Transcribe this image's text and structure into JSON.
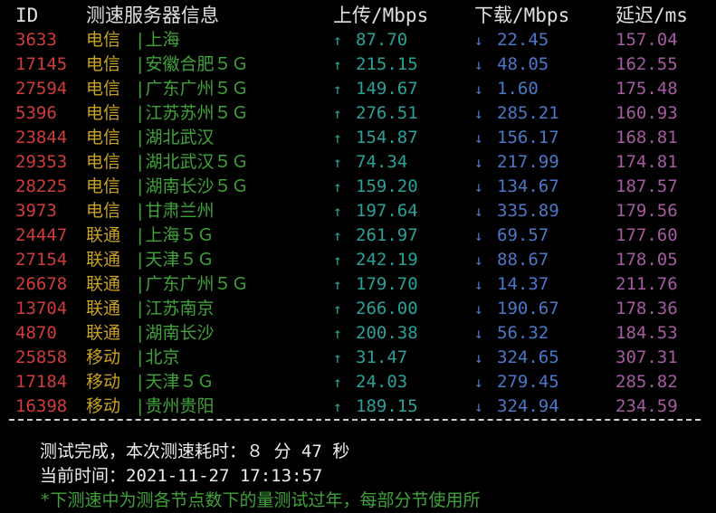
{
  "header": {
    "id": "ID",
    "server": "测速服务器信息",
    "upload": "上传/Mbps",
    "download": "下载/Mbps",
    "latency": "延迟/ms"
  },
  "arrows": {
    "up": "↑",
    "down": "↓"
  },
  "rows": [
    {
      "id": "3633",
      "isp": "电信",
      "location": "|上海",
      "up": "87.70",
      "down": "22.45",
      "latency": "157.04"
    },
    {
      "id": "17145",
      "isp": "电信",
      "location": "|安徽合肥５Ｇ",
      "up": "215.15",
      "down": "48.05",
      "latency": "162.55"
    },
    {
      "id": "27594",
      "isp": "电信",
      "location": "|广东广州５Ｇ",
      "up": "149.67",
      "down": "1.60",
      "latency": "175.48"
    },
    {
      "id": "5396",
      "isp": "电信",
      "location": "|江苏苏州５Ｇ",
      "up": "276.51",
      "down": "285.21",
      "latency": "160.93"
    },
    {
      "id": "23844",
      "isp": "电信",
      "location": "|湖北武汉",
      "up": "154.87",
      "down": "156.17",
      "latency": "168.81"
    },
    {
      "id": "29353",
      "isp": "电信",
      "location": "|湖北武汉５Ｇ",
      "up": "74.34",
      "down": "217.99",
      "latency": "174.81"
    },
    {
      "id": "28225",
      "isp": "电信",
      "location": "|湖南长沙５Ｇ",
      "up": "159.20",
      "down": "134.67",
      "latency": "187.57"
    },
    {
      "id": "3973",
      "isp": "电信",
      "location": "|甘肃兰州",
      "up": "197.64",
      "down": "335.89",
      "latency": "179.56"
    },
    {
      "id": "24447",
      "isp": "联通",
      "location": "|上海５Ｇ",
      "up": "261.97",
      "down": "69.57",
      "latency": "177.60"
    },
    {
      "id": "27154",
      "isp": "联通",
      "location": "|天津５Ｇ",
      "up": "242.19",
      "down": "88.67",
      "latency": "178.05"
    },
    {
      "id": "26678",
      "isp": "联通",
      "location": "|广东广州５Ｇ",
      "up": "179.70",
      "down": "14.37",
      "latency": "211.76"
    },
    {
      "id": "13704",
      "isp": "联通",
      "location": "|江苏南京",
      "up": "266.00",
      "down": "190.67",
      "latency": "178.36"
    },
    {
      "id": "4870",
      "isp": "联通",
      "location": "|湖南长沙",
      "up": "200.38",
      "down": "56.32",
      "latency": "184.53"
    },
    {
      "id": "25858",
      "isp": "移动",
      "location": "|北京",
      "up": "31.47",
      "down": "324.65",
      "latency": "307.31"
    },
    {
      "id": "17184",
      "isp": "移动",
      "location": "|天津５Ｇ",
      "up": "24.03",
      "down": "279.45",
      "latency": "285.82"
    },
    {
      "id": "16398",
      "isp": "移动",
      "location": "|贵州贵阳",
      "up": "189.15",
      "down": "324.94",
      "latency": "234.59"
    }
  ],
  "footer": {
    "complete": "测试完成，本次测速耗时：８ 分 47 秒",
    "time": "当前时间：2021-11-27 17:13:57"
  },
  "cutoff_text": "*下测速中为测各节点数下的量测试过年，每部分节使用所"
}
